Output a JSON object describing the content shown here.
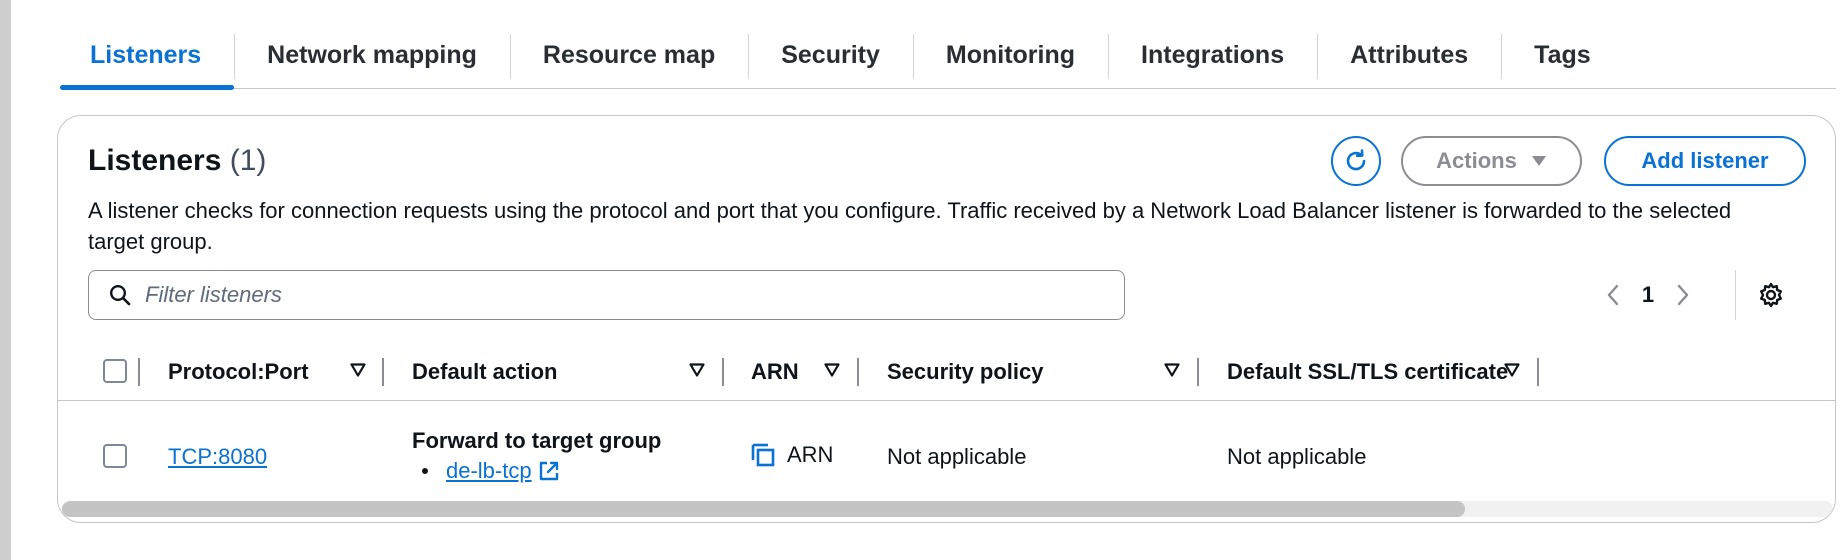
{
  "tabs": [
    {
      "label": "Listeners",
      "active": true
    },
    {
      "label": "Network mapping"
    },
    {
      "label": "Resource map"
    },
    {
      "label": "Security"
    },
    {
      "label": "Monitoring"
    },
    {
      "label": "Integrations"
    },
    {
      "label": "Attributes"
    },
    {
      "label": "Tags"
    }
  ],
  "listeners": {
    "title": "Listeners",
    "count": "(1)",
    "description": "A listener checks for connection requests using the protocol and port that you configure. Traffic received by a Network Load Balancer listener is forwarded to the selected target group.",
    "actions_label": "Actions",
    "add_label": "Add listener",
    "filter_placeholder": "Filter listeners",
    "page": "1",
    "columns": [
      "Protocol:Port",
      "Default action",
      "ARN",
      "Security policy",
      "Default SSL/TLS certificate"
    ],
    "rows": [
      {
        "protocol_port": "TCP:8080",
        "default_action": "Forward to target group",
        "target_group": "de-lb-tcp",
        "arn": "ARN",
        "security_policy": "Not applicable",
        "certificate": "Not applicable"
      }
    ]
  },
  "colors": {
    "accent": "#0972d3",
    "text": "#0f141a",
    "disabled": "#8c8c94"
  }
}
